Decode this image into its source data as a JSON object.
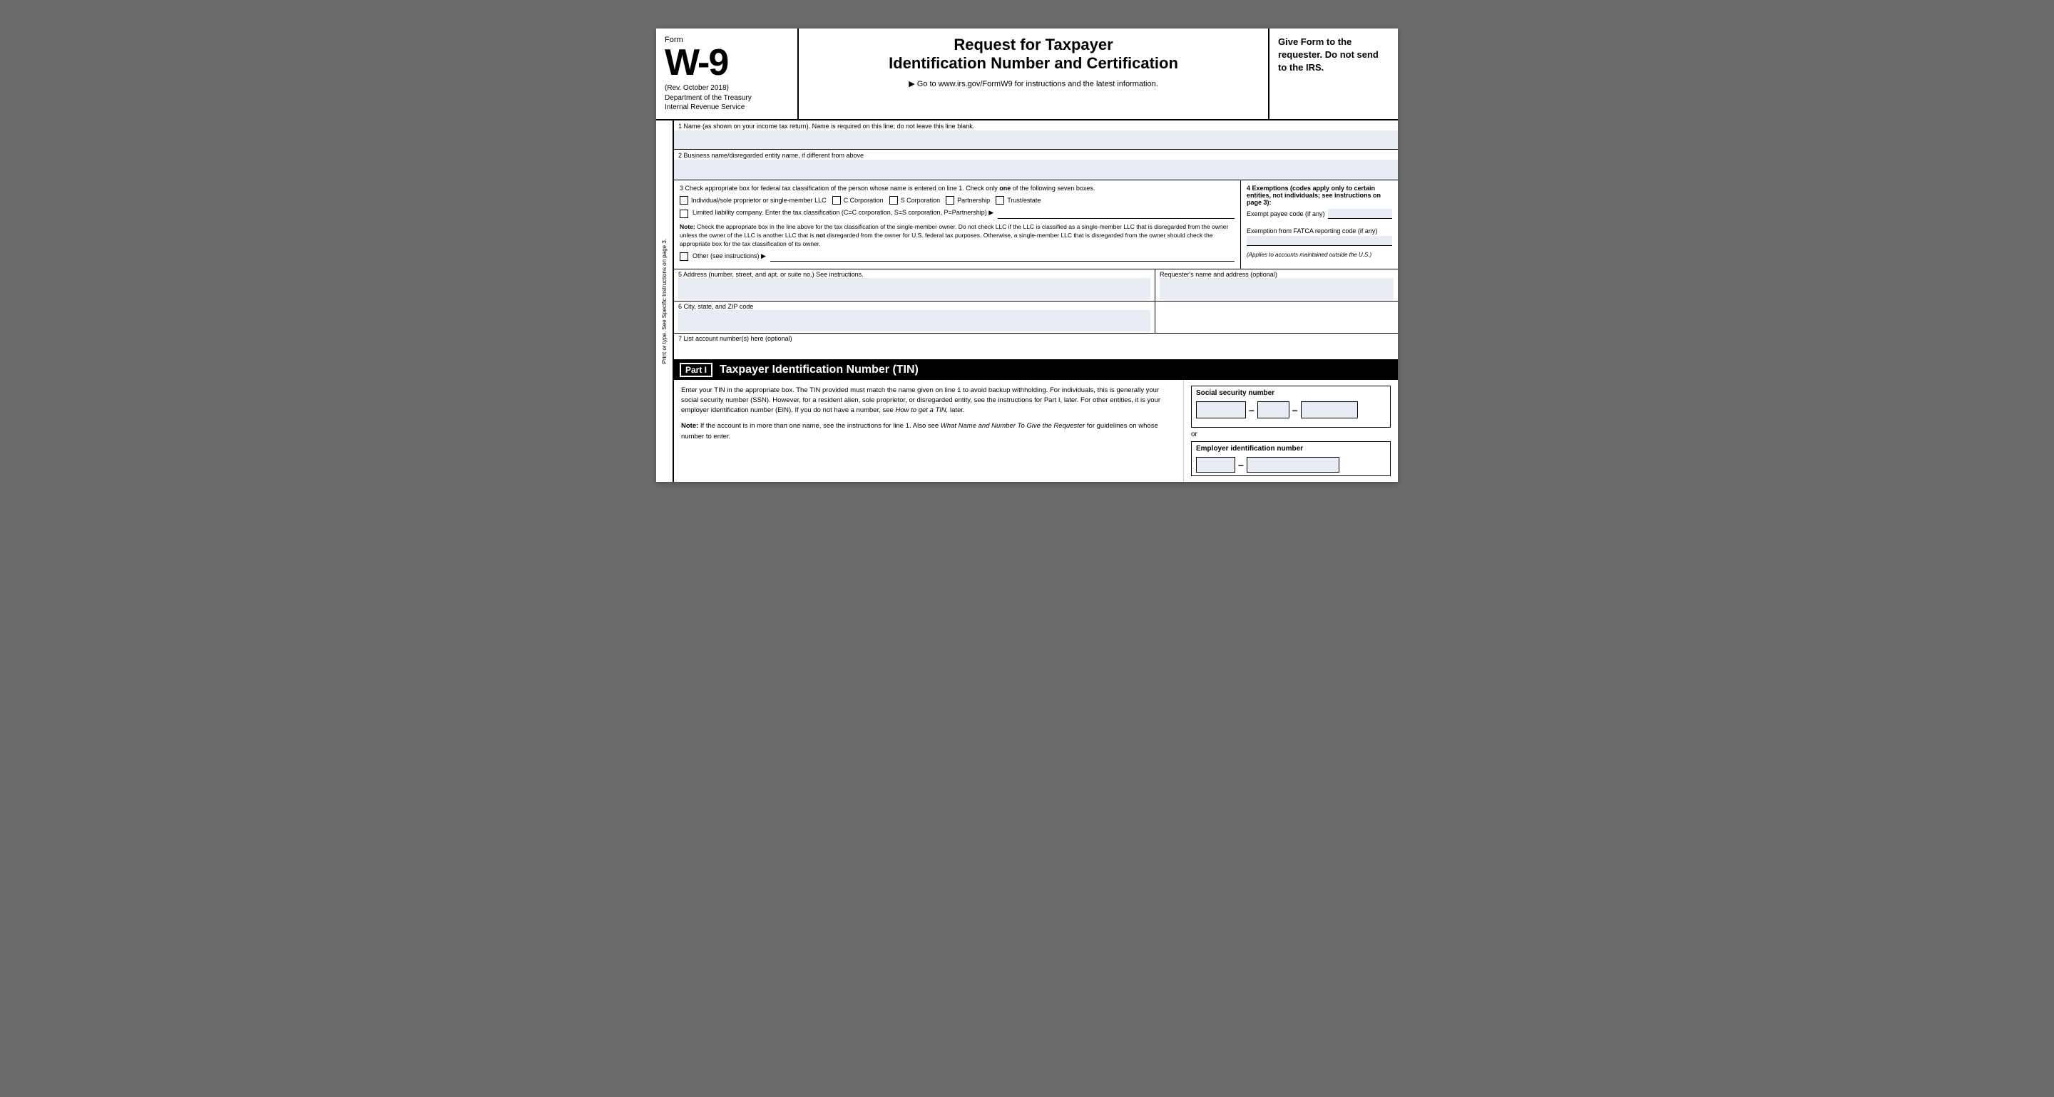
{
  "form": {
    "number": "W-9",
    "label": "Form",
    "rev": "(Rev. October 2018)",
    "dept": "Department of the Treasury",
    "irs": "Internal Revenue Service",
    "title": "Request for Taxpayer",
    "subtitle": "Identification Number and Certification",
    "goto": "▶ Go to www.irs.gov/FormW9 for instructions and the latest information.",
    "give_form": "Give Form to the requester. Do not send to the IRS."
  },
  "fields": {
    "line1_label": "1  Name (as shown on your income tax return). Name is required on this line; do not leave this line blank.",
    "line2_label": "2  Business name/disregarded entity name, if different from above",
    "line3_label": "3  Check appropriate box for federal tax classification of the person whose name is entered on line 1. Check only",
    "line3_label_one": "one",
    "line3_label_end": "of the following seven boxes.",
    "checkbox_individual": "Individual/sole proprietor or single-member LLC",
    "checkbox_c_corp": "C Corporation",
    "checkbox_s_corp": "S Corporation",
    "checkbox_partnership": "Partnership",
    "checkbox_trust": "Trust/estate",
    "llc_label": "Limited liability company. Enter the tax classification (C=C corporation, S=S corporation, P=Partnership) ▶",
    "note_bold": "Note:",
    "note_text": " Check the appropriate box in the line above for the tax classification of the single-member owner.  Do not check LLC if the LLC is classified as a single-member LLC that is disregarded from the owner unless the owner of the LLC is another LLC that is",
    "note_not": "not",
    "note_text2": " disregarded from the owner for U.S. federal tax purposes. Otherwise, a single-member LLC that is disregarded from the owner should check the appropriate box for the tax classification of its owner.",
    "other_label": "Other (see instructions) ▶",
    "exemptions_title": "4  Exemptions (codes apply only to certain entities, not individuals; see instructions on page 3):",
    "exempt_payee": "Exempt payee code (if any)",
    "fatca_label": "Exemption from FATCA reporting code (if any)",
    "fatca_note": "(Applies to accounts maintained outside the U.S.)",
    "line5_label": "5  Address (number, street, and apt. or suite no.) See instructions.",
    "requester_label": "Requester's name and address (optional)",
    "line6_label": "6  City, state, and ZIP code",
    "line7_label": "7  List account number(s) here (optional)",
    "side_label": "Print or type.    See Specific Instructions on page 3.",
    "part1_label": "Part I",
    "part1_title": "Taxpayer Identification Number (TIN)",
    "part1_text": "Enter your TIN in the appropriate box. The TIN provided must match the name given on line 1 to avoid backup withholding. For individuals, this is generally your social security number (SSN). However, for a resident alien, sole proprietor, or disregarded entity, see the instructions for Part I, later. For other entities, it is your employer identification number (EIN). If you do not have a number, see",
    "part1_italic": "How to get a TIN,",
    "part1_text2": " later.",
    "note2_bold": "Note:",
    "note2_text": " If the account is in more than one name, see the instructions for line 1. Also see",
    "note2_italic": "What Name and Number To Give the Requester",
    "note2_text2": " for guidelines on whose number to enter.",
    "ssn_title": "Social security number",
    "ssn_dash1": "–",
    "ssn_dash2": "–",
    "or_text": "or",
    "ein_title": "Employer identification number",
    "ein_dash": "–"
  }
}
